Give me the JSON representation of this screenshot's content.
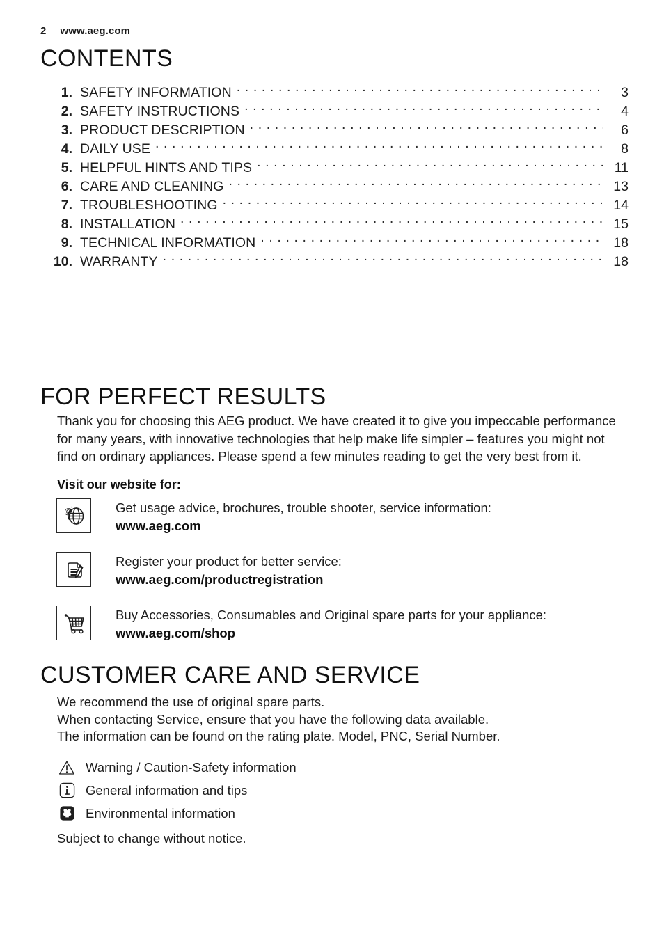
{
  "header": {
    "page_number": "2",
    "website": "www.aeg.com"
  },
  "contents": {
    "heading": "CONTENTS",
    "entries": [
      {
        "num": "1.",
        "label": "SAFETY INFORMATION",
        "page": "3"
      },
      {
        "num": "2.",
        "label": "SAFETY INSTRUCTIONS",
        "page": "4"
      },
      {
        "num": "3.",
        "label": "PRODUCT DESCRIPTION",
        "page": "6"
      },
      {
        "num": "4.",
        "label": "DAILY USE",
        "page": "8"
      },
      {
        "num": "5.",
        "label": "HELPFUL HINTS AND TIPS",
        "page": "11"
      },
      {
        "num": "6.",
        "label": "CARE AND CLEANING",
        "page": "13"
      },
      {
        "num": "7.",
        "label": "TROUBLESHOOTING",
        "page": "14"
      },
      {
        "num": "8.",
        "label": "INSTALLATION",
        "page": "15"
      },
      {
        "num": "9.",
        "label": "TECHNICAL INFORMATION",
        "page": "18"
      },
      {
        "num": "10.",
        "label": "WARRANTY",
        "page": "18"
      }
    ]
  },
  "perfect_results": {
    "heading": "FOR PERFECT RESULTS",
    "paragraph": "Thank you for choosing this AEG product. We have created it to give you impeccable performance for many years, with innovative technologies that help make life simpler – features you might not find on ordinary appliances. Please spend a few minutes reading to get the very best from it.",
    "visit_label": "Visit our website for:",
    "links": [
      {
        "icon": "globe-at-icon",
        "description": "Get usage advice, brochures, trouble shooter, service information:",
        "url": "www.aeg.com"
      },
      {
        "icon": "document-pen-icon",
        "description": "Register your product for better service:",
        "url": "www.aeg.com/productregistration"
      },
      {
        "icon": "shopping-cart-icon",
        "description": "Buy Accessories, Consumables and Original spare parts for your appliance:",
        "url": "www.aeg.com/shop"
      }
    ]
  },
  "customer_care": {
    "heading": "CUSTOMER CARE AND SERVICE",
    "lines": [
      "We recommend the use of original spare parts.",
      "When contacting Service, ensure that you have the following data available.",
      "The information can be found on the rating plate. Model, PNC, Serial Number."
    ]
  },
  "legend": [
    {
      "icon": "warning-triangle-icon",
      "text": "Warning / Caution-Safety information"
    },
    {
      "icon": "info-icon",
      "text": "General information and tips"
    },
    {
      "icon": "environment-leaf-icon",
      "text": "Environmental information"
    }
  ],
  "footnote": "Subject to change without notice.",
  "colors": {
    "text": "#1d1d1d",
    "heading": "#111111",
    "icon_stroke": "#2a2a2a",
    "background": "#ffffff"
  }
}
